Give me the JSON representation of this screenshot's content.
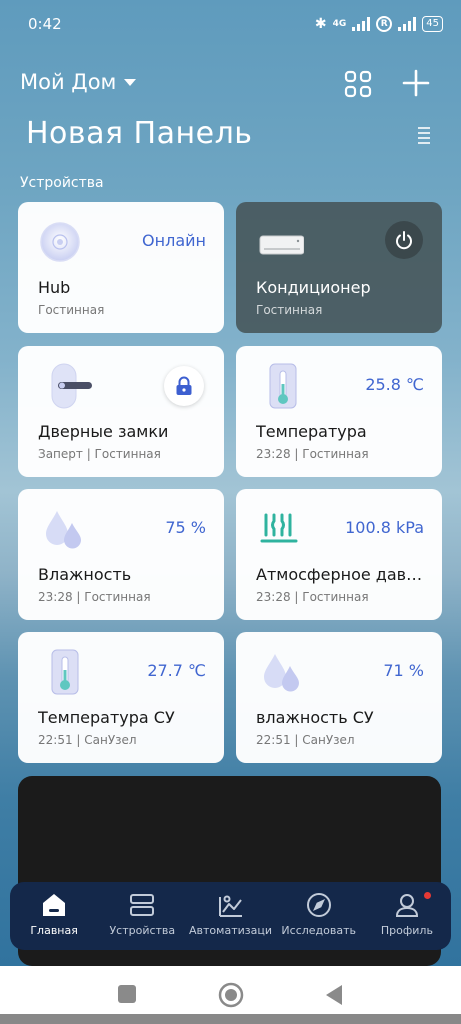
{
  "status_bar": {
    "time": "0:42",
    "network": "4G",
    "battery": "45"
  },
  "header": {
    "home_name": "Мой Дом",
    "panel_title": "Новая Панель",
    "section_label": "Устройства"
  },
  "devices": [
    {
      "name": "Hub",
      "sub": "Гостинная",
      "value": "Онлайн",
      "icon": "hub-icon"
    },
    {
      "name": "Кондиционер",
      "sub": "Гостинная",
      "value": "",
      "icon": "air-conditioner-icon"
    },
    {
      "name": "Дверные замки",
      "sub": "Заперт | Гостинная",
      "value": "",
      "icon": "door-lock-icon"
    },
    {
      "name": "Температура",
      "sub": "23:28 | Гостинная",
      "value": "25.8 ℃",
      "icon": "thermometer-icon"
    },
    {
      "name": "Влажность",
      "sub": "23:28 | Гостинная",
      "value": "75 %",
      "icon": "humidity-icon"
    },
    {
      "name": "Атмосферное давление",
      "sub": "23:28 | Гостинная",
      "value": "100.8 kPa",
      "icon": "pressure-icon"
    },
    {
      "name": "Температура СУ",
      "sub": "22:51 | СанУзел",
      "value": "27.7 ℃",
      "icon": "thermometer-icon"
    },
    {
      "name": "влажность СУ",
      "sub": "22:51 | СанУзел",
      "value": "71 %",
      "icon": "humidity-icon"
    }
  ],
  "nav": [
    {
      "label": "Главная",
      "icon": "home-icon"
    },
    {
      "label": "Устройства",
      "icon": "devices-icon"
    },
    {
      "label": "Автоматизаци",
      "icon": "automation-icon"
    },
    {
      "label": "Исследовать",
      "icon": "compass-icon"
    },
    {
      "label": "Профиль",
      "icon": "profile-icon"
    }
  ],
  "colors": {
    "accent": "#4066d0",
    "nav_bg": "#14284a",
    "dark_card": "#465458"
  }
}
